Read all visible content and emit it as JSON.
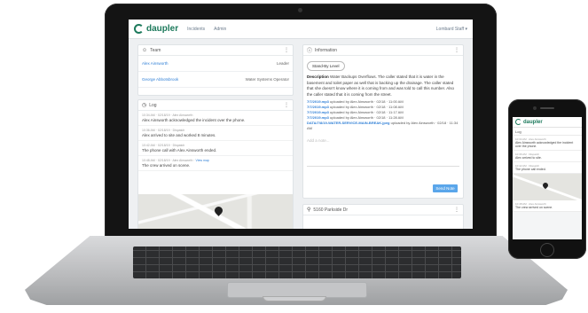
{
  "app": {
    "brand": "daupler",
    "nav": [
      "Incidents",
      "Admin"
    ],
    "user_menu": "Lombard Staff ▾"
  },
  "team": {
    "title": "Team",
    "rows": [
      {
        "name": "Alex Ainsworth",
        "role": "Leader"
      },
      {
        "name": "George Abbotsbrook",
        "role": "Water Systems Operator"
      }
    ]
  },
  "log": {
    "title": "Log",
    "entries": [
      {
        "meta": "10:34 AM · 02/18/19 · Alex Ainsworth",
        "link": "",
        "text": "Alex Ainsworth acknowledged the incident over the phone."
      },
      {
        "meta": "10:36 AM · 02/18/19 · Dispatch",
        "link": "",
        "text": "Alex arrived to site and worked 8 minutes."
      },
      {
        "meta": "10:42 AM · 02/18/19 · Dispatch",
        "link": "",
        "text": "The phone call with Alex Ainsworth ended."
      },
      {
        "meta": "10:48 AM · 02/18/19 · Alex Ainsworth ·",
        "link": "View map",
        "text": "The crew arrived on scene."
      }
    ]
  },
  "information": {
    "title": "Information",
    "chip": "Stand-By Level",
    "description_label": "Description",
    "description": "Water Backups Overflows. The caller stated that it is water in the basement and toilet paper as well that is backing up the drainage. The caller stated that she doesn't know where it is coming from and was told to call this number. Also the caller stated that it is coming from the street.",
    "audio": [
      {
        "file": "7/7/2019.mp3",
        "detail": "uploaded by Alex Ainsworth · 02/18 · 11:00 AM"
      },
      {
        "file": "7/7/2019.mp3",
        "detail": "uploaded by Alex Ainsworth · 02/18 · 11:08 AM"
      },
      {
        "file": "7/7/2019.mp3",
        "detail": "uploaded by Alex Ainsworth · 02/18 · 11:17 AM"
      },
      {
        "file": "7/7/2019.mp3",
        "detail": "uploaded by Alex Ainsworth · 02/18 · 11:28 AM"
      },
      {
        "file": "DATA/7/8/19-WATER-SERVICE-MAIN-BREAK.jpeg",
        "detail": "uploaded by Alex Ainsworth · 02/18 · 11:34 AM"
      }
    ],
    "comment_placeholder": "Add a note...",
    "send_label": "Send Note"
  },
  "location": {
    "title": "5160 Parkside Dr"
  },
  "phone": {
    "brand": "daupler",
    "log_title": "Log",
    "entries": [
      {
        "meta": "10:34 AM · Alex Ainsworth",
        "text": "Alex Ainsworth acknowledged the incident over the phone."
      },
      {
        "meta": "10:36 AM · Dispatch",
        "text": "Alex arrived to site."
      },
      {
        "meta": "10:42 AM · Dispatch",
        "text": "The phone call ended."
      },
      {
        "meta": "10:48 AM · Alex Ainsworth",
        "text": "The crew arrived on scene."
      }
    ]
  }
}
